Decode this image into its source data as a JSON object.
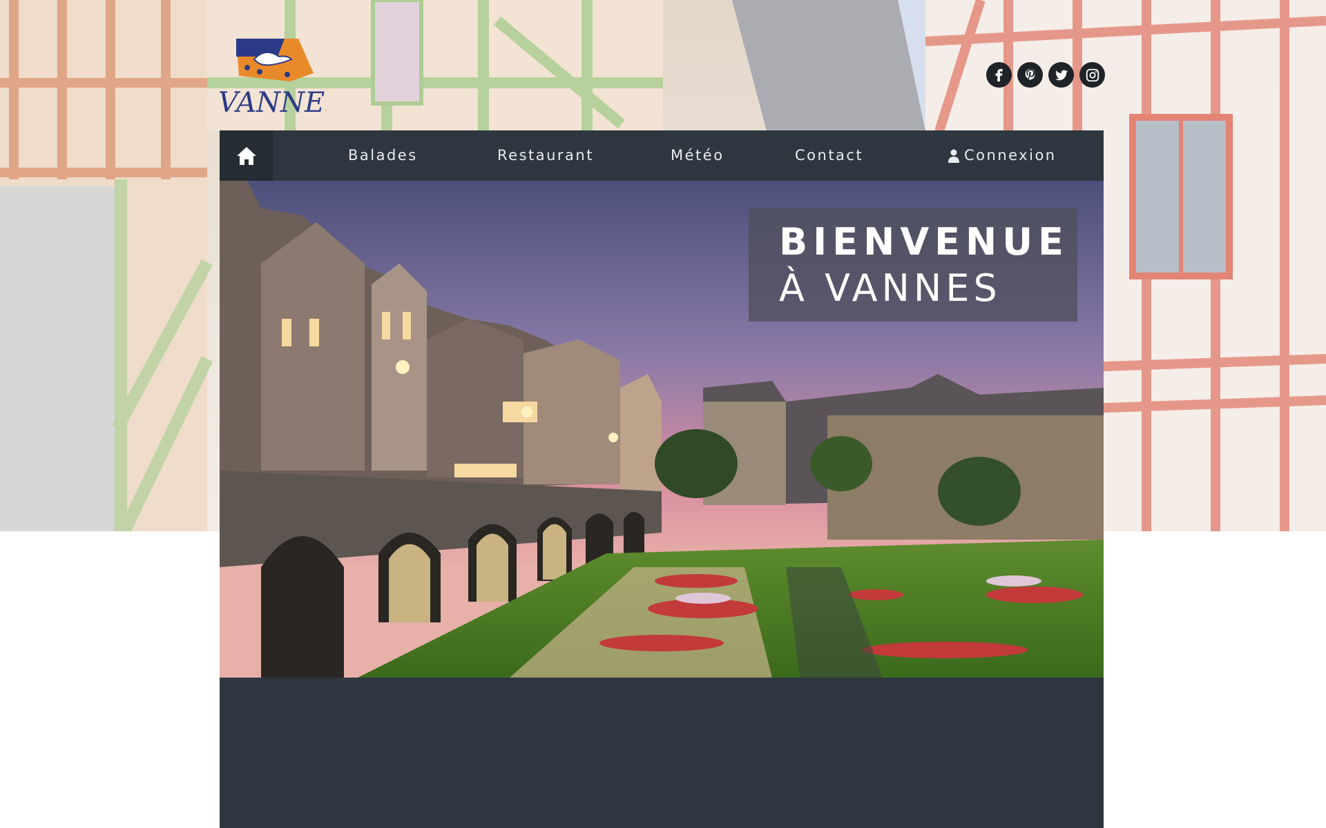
{
  "brand": {
    "logo_text": "VANNES"
  },
  "social": [
    {
      "name": "facebook",
      "icon": "facebook-icon"
    },
    {
      "name": "pinterest",
      "icon": "pinterest-icon"
    },
    {
      "name": "twitter",
      "icon": "twitter-icon"
    },
    {
      "name": "instagram",
      "icon": "instagram-icon"
    }
  ],
  "nav": {
    "home_icon": "home-icon",
    "items": [
      "Balades",
      "Restaurant",
      "Météo",
      "Contact"
    ],
    "login_label": "Connexion",
    "login_icon": "user-icon"
  },
  "hero": {
    "title_line1": "BIENVENUE",
    "title_line2": "À VANNES"
  },
  "colors": {
    "nav_bg": "#2e3740",
    "home_bg": "#252c33",
    "logo_blue": "#2a3a86",
    "logo_orange": "#e98a2a"
  }
}
